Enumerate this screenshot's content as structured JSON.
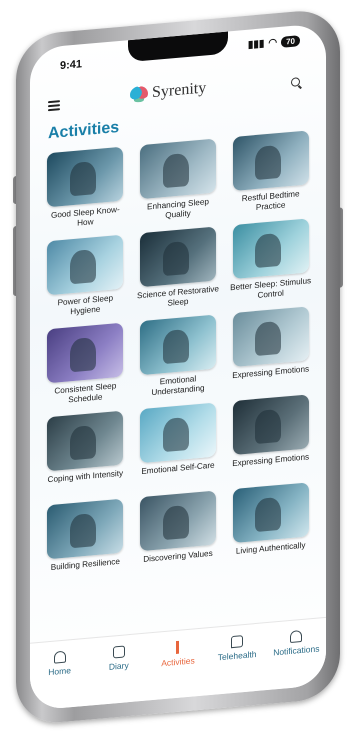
{
  "status": {
    "time": "9:41",
    "battery": "70",
    "signal_icon": "signal-icon",
    "wifi_icon": "wifi-icon"
  },
  "header": {
    "app_name": "Syrenity",
    "logo_icon": "brain-logo-icon",
    "menu_icon": "hamburger-menu-icon",
    "search_icon": "search-icon"
  },
  "page": {
    "title": "Activities"
  },
  "activities": [
    {
      "label": "Good Sleep Know-How"
    },
    {
      "label": "Enhancing Sleep Quality"
    },
    {
      "label": "Restful Bedtime Practice"
    },
    {
      "label": "Power of Sleep Hygiene"
    },
    {
      "label": "Science of Restorative Sleep"
    },
    {
      "label": "Better Sleep: Stimulus Control"
    },
    {
      "label": "Consistent Sleep Schedule"
    },
    {
      "label": "Emotional Understanding"
    },
    {
      "label": "Expressing Emotions"
    },
    {
      "label": "Coping with Intensity"
    },
    {
      "label": "Emotional Self-Care"
    },
    {
      "label": "Expressing Emotions"
    },
    {
      "label": "Building Resilience"
    },
    {
      "label": "Discovering Values"
    },
    {
      "label": "Living Authentically"
    }
  ],
  "nav": {
    "items": [
      {
        "label": "Home",
        "icon": "home-icon"
      },
      {
        "label": "Diary",
        "icon": "book-icon"
      },
      {
        "label": "Activities",
        "icon": "activity-person-icon",
        "active": true
      },
      {
        "label": "Telehealth",
        "icon": "chat-icon"
      },
      {
        "label": "Notifications",
        "icon": "bell-icon"
      }
    ]
  },
  "colors": {
    "accent": "#1a7fa8",
    "active": "#e8663d"
  }
}
